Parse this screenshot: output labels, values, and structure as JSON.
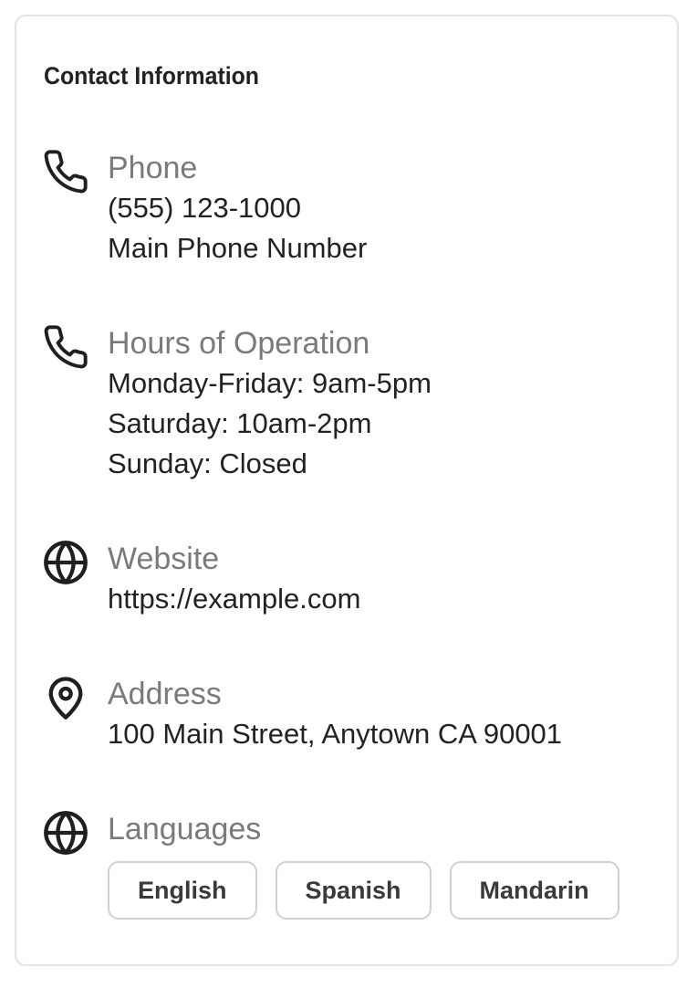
{
  "card": {
    "title": "Contact Information"
  },
  "sections": {
    "phone": {
      "icon": "phone-icon",
      "label": "Phone",
      "lines": [
        "(555) 123-1000",
        "Main Phone Number"
      ]
    },
    "hours": {
      "icon": "phone-icon",
      "label": "Hours of Operation",
      "lines": [
        "Monday-Friday: 9am-5pm",
        "Saturday: 10am-2pm",
        "Sunday: Closed"
      ]
    },
    "website": {
      "icon": "globe-icon",
      "label": "Website",
      "lines": [
        "https://example.com"
      ]
    },
    "address": {
      "icon": "map-pin-icon",
      "label": "Address",
      "lines": [
        "100 Main Street, Anytown CA 90001"
      ]
    },
    "languages": {
      "icon": "globe-icon",
      "label": "Languages",
      "chips": [
        "English",
        "Spanish",
        "Mandarin"
      ]
    }
  },
  "colors": {
    "label": "#7a7a7a",
    "text": "#222222",
    "border": "#e3e3e6",
    "chip_border": "#cfcfd4"
  }
}
